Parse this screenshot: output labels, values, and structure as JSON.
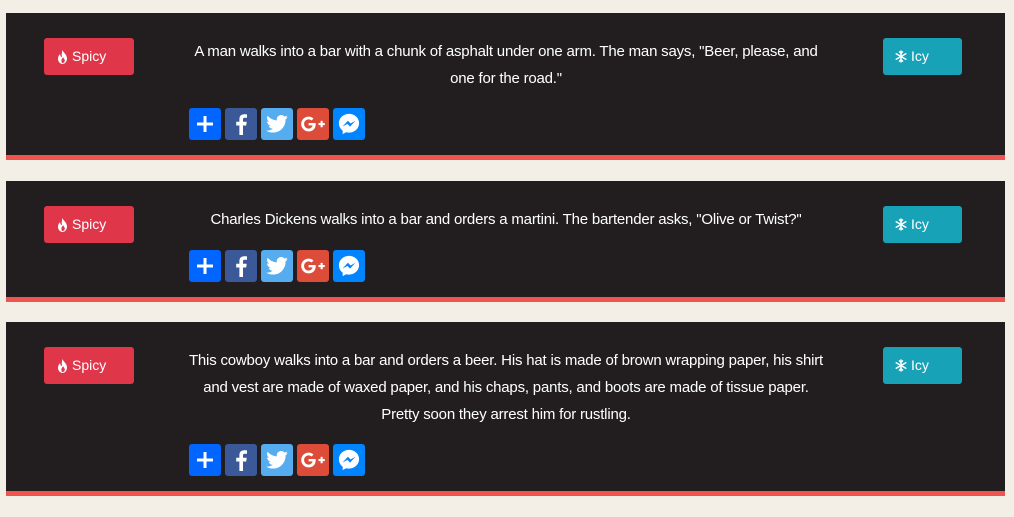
{
  "buttons": {
    "spicy_label": "Spicy",
    "icy_label": "Icy"
  },
  "colors": {
    "spicy": "#e0364a",
    "icy": "#17a2b8",
    "card_bg": "#221e1f",
    "accent_border": "#f0544f",
    "page_bg": "#f3efe6"
  },
  "jokes": [
    {
      "text": "A man walks into a bar with a chunk of asphalt under one arm. The man says, \"Beer, please, and one for the road.\""
    },
    {
      "text": "Charles Dickens walks into a bar and orders a martini. The bartender asks, \"Olive or Twist?\""
    },
    {
      "text": "This cowboy walks into a bar and orders a beer. His hat is made of brown wrapping paper, his shirt and vest are made of waxed paper, and his chaps, pants, and boots are made of tissue paper. Pretty soon they arrest him for rustling."
    }
  ],
  "share_icons": [
    "add-icon",
    "facebook-icon",
    "twitter-icon",
    "google-plus-icon",
    "messenger-icon"
  ]
}
